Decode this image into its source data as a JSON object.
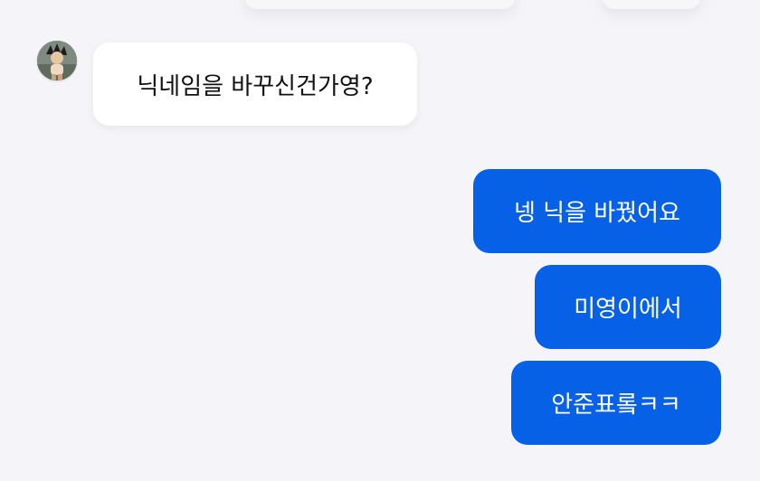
{
  "chat": {
    "incoming": [
      {
        "text": "닉네임을 바꾸신건가영?"
      }
    ],
    "outgoing": [
      {
        "text": "넹 닉을 바꿨어요"
      },
      {
        "text": "미영이에서"
      },
      {
        "text": "안준표롴ㅋㅋ"
      }
    ]
  },
  "colors": {
    "background": "#f5f5f9",
    "incoming_bubble": "#ffffff",
    "outgoing_bubble": "#0761e6"
  }
}
